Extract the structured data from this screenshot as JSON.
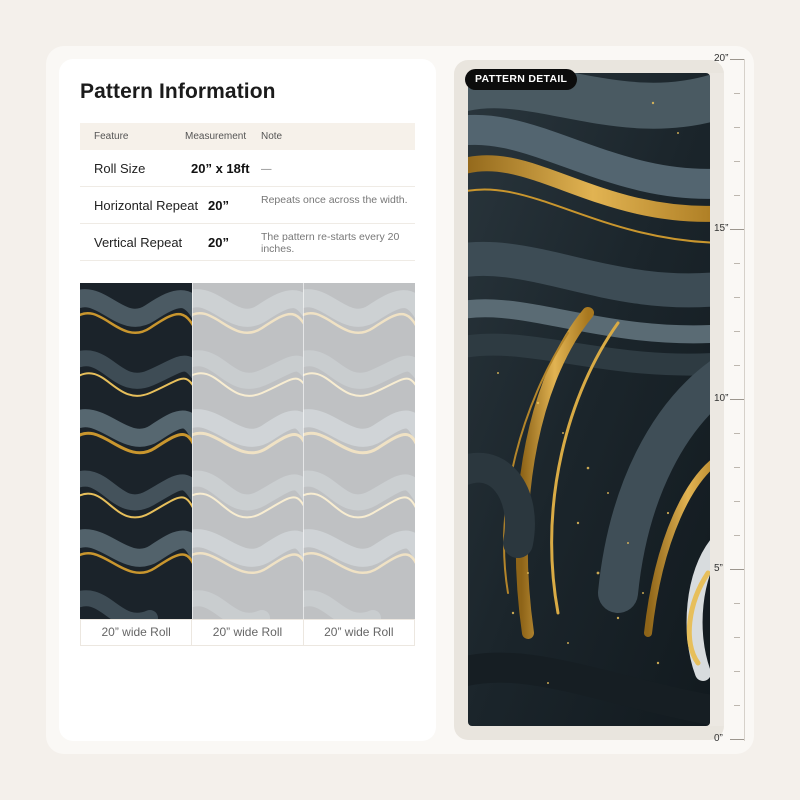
{
  "title": "Pattern Information",
  "table": {
    "headers": {
      "feature": "Feature",
      "measurement": "Measurement",
      "note": "Note"
    },
    "rows": [
      {
        "feature": "Roll Size",
        "measurement": "20” x 18ft",
        "note": "—"
      },
      {
        "feature": "Horizontal Repeat",
        "measurement": "20”",
        "note": "Repeats once across the width."
      },
      {
        "feature": "Vertical Repeat",
        "measurement": "20”",
        "note": "The pattern re-starts every 20 inches."
      }
    ]
  },
  "rolls": [
    {
      "label": "20” wide Roll"
    },
    {
      "label": "20” wide Roll"
    },
    {
      "label": "20” wide Roll"
    }
  ],
  "detail": {
    "badge": "PATTERN DETAIL"
  },
  "ruler": {
    "labels": [
      "20”",
      "15”",
      "10”",
      "5”",
      "0”"
    ]
  },
  "colors": {
    "marble_dark": "#1b232a",
    "marble_slate": "#3c4a52",
    "gold": "#c9962e",
    "gold_light": "#e7bf5b"
  }
}
